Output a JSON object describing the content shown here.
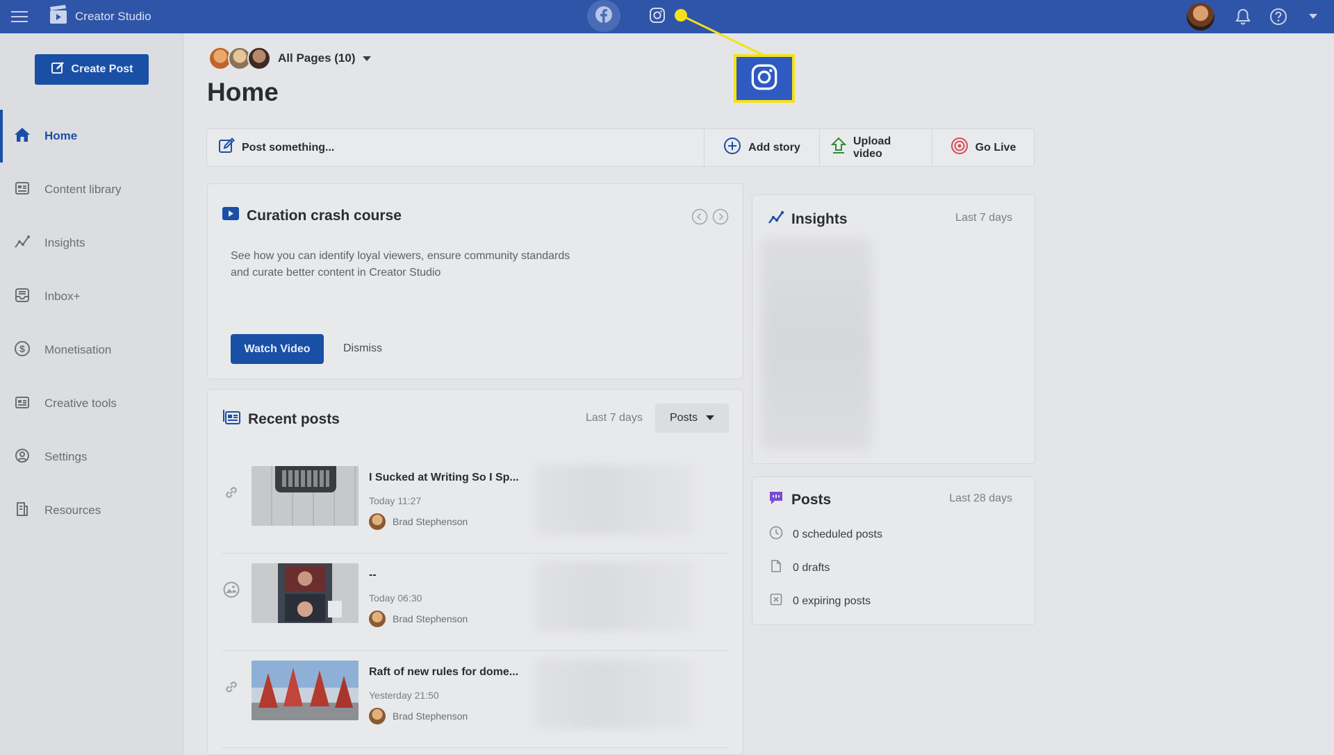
{
  "topbar": {
    "app_name": "Creator Studio",
    "icons": [
      "menu-icon",
      "clapper-icon",
      "facebook-icon",
      "instagram-icon",
      "bell-icon",
      "help-icon",
      "caret-down-icon"
    ]
  },
  "sidebar": {
    "create_label": "Create Post",
    "items": [
      {
        "label": "Home",
        "icon": "home-icon",
        "active": true
      },
      {
        "label": "Content library",
        "icon": "library-icon"
      },
      {
        "label": "Insights",
        "icon": "insights-icon"
      },
      {
        "label": "Inbox+",
        "icon": "inbox-icon"
      },
      {
        "label": "Monetisation",
        "icon": "dollar-icon"
      },
      {
        "label": "Creative tools",
        "icon": "creative-icon"
      },
      {
        "label": "Settings",
        "icon": "settings-icon"
      },
      {
        "label": "Resources",
        "icon": "resources-icon"
      }
    ]
  },
  "header": {
    "pages_selector": "All Pages (10)",
    "title": "Home"
  },
  "actions": {
    "post": "Post something...",
    "story": "Add story",
    "upload": "Upload video",
    "live": "Go Live"
  },
  "curation": {
    "title": "Curation crash course",
    "line1": "See how you can identify loyal viewers, ensure community standards",
    "line2": "and curate better content in Creator Studio",
    "watch": "Watch Video",
    "dismiss": "Dismiss"
  },
  "recent": {
    "title": "Recent posts",
    "range": "Last 7 days",
    "filter": "Posts",
    "posts": [
      {
        "title": "I Sucked at Writing So I Sp...",
        "time": "Today 11:27",
        "author": "Brad Stephenson"
      },
      {
        "title": "--",
        "time": "Today 06:30",
        "author": "Brad Stephenson"
      },
      {
        "title": "Raft of new rules for dome...",
        "time": "Yesterday 21:50",
        "author": "Brad Stephenson"
      }
    ]
  },
  "insights": {
    "title": "Insights",
    "range": "Last 7 days"
  },
  "posts_card": {
    "title": "Posts",
    "range": "Last 28 days",
    "scheduled": "0 scheduled posts",
    "drafts": "0 drafts",
    "expiring": "0 expiring posts"
  },
  "colors": {
    "topbar": "#2f55a8",
    "accent": "#1a4fa6",
    "highlight": "#f5e11a"
  }
}
